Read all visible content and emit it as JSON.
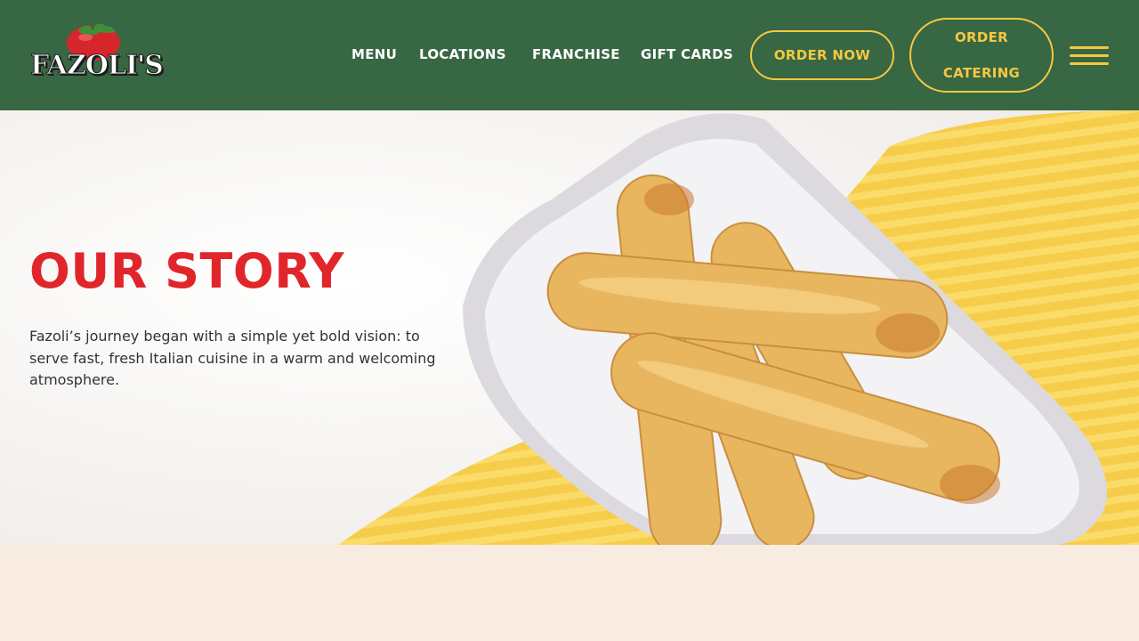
{
  "header": {
    "logo_text": "FAZOLI'S",
    "nav": [
      {
        "label": "MENU"
      },
      {
        "label": "LOCATIONS"
      },
      {
        "label": "FRANCHISE"
      },
      {
        "label": "GIFT CARDS"
      }
    ],
    "order_now_label": "ORDER NOW",
    "order_catering_label": "ORDER CATERING",
    "menu_icon": "hamburger-icon"
  },
  "hero": {
    "title": "OUR STORY",
    "body": "Fazoli’s journey began with a simple yet bold vision: to serve fast, fresh Italian cuisine in a warm and welcoming atmosphere.",
    "image": "breadsticks-on-plate"
  },
  "colors": {
    "header_bg": "#386743",
    "accent_yellow": "#f5c842",
    "title_red": "#e1262b",
    "lower_bg": "#f8ece0"
  }
}
